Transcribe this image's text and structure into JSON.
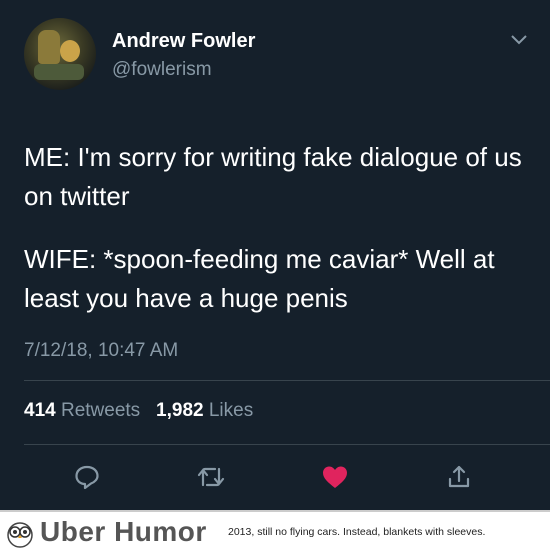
{
  "tweet": {
    "display_name": "Andrew Fowler",
    "handle": "@fowlerism",
    "line1": "ME: I'm sorry for writing fake dialogue of us on twitter",
    "line2": "WIFE: *spoon-feeding me caviar* Well at least you have a huge penis",
    "timestamp": "7/12/18, 10:47 AM",
    "retweets_count": "414",
    "retweets_label": "Retweets",
    "likes_count": "1,982",
    "likes_label": "Likes",
    "liked": true,
    "like_color": "#e0245e",
    "icon_color": "#8899a6"
  },
  "footer": {
    "brand": "Uber Humor",
    "caption": "2013, still no flying cars. Instead, blankets with sleeves."
  }
}
